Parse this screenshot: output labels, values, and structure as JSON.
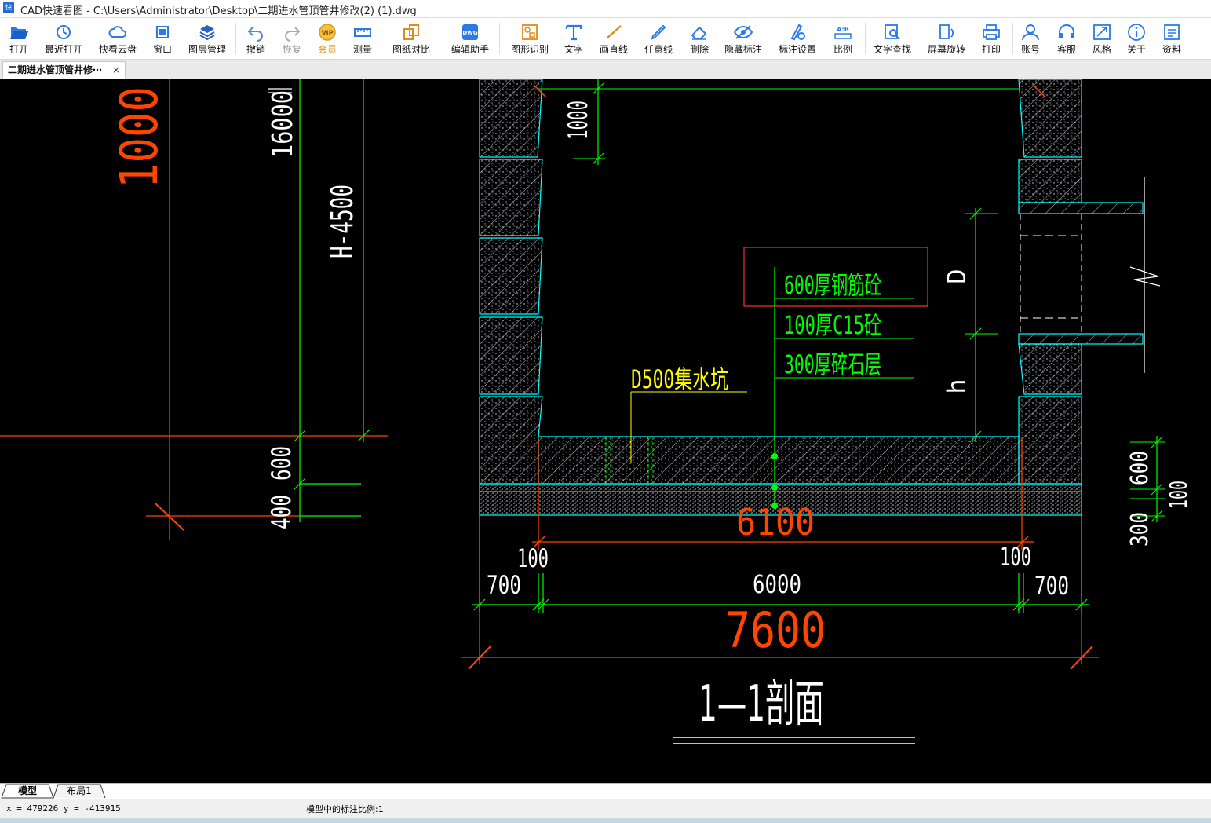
{
  "window": {
    "title": "CAD快速看图 - C:\\Users\\Administrator\\Desktop\\二期进水管顶管井修改(2) (1).dwg",
    "logo_text": "快图"
  },
  "toolbar": {
    "open": "打开",
    "recent": "最近打开",
    "cloud": "快看云盘",
    "window": "窗口",
    "layers": "图层管理",
    "undo": "撤销",
    "redo": "恢复",
    "vip": "会员",
    "measure": "测量",
    "compare": "图纸对比",
    "editor": "编辑助手",
    "shape_recog": "图形识别",
    "text": "文字",
    "line": "画直线",
    "freeline": "任意线",
    "delete": "删除",
    "hide_dim": "隐藏标注",
    "dim_settings": "标注设置",
    "scale": "比例",
    "text_find": "文字查找",
    "rotate": "屏幕旋转",
    "print": "打印",
    "account": "账号",
    "service": "客服",
    "style": "风格",
    "about": "关于",
    "resources": "资料"
  },
  "tab": {
    "label": "二期进水管顶管井修⋯",
    "close": "×"
  },
  "drawing": {
    "left": {
      "dim_1000": "1000",
      "dim_16000": "16000",
      "dim_h4500": "H-4500",
      "dim_600": "600",
      "dim_400": "400"
    },
    "inner_top_dim": "1000",
    "labels": {
      "c30": "600厚钢筋砼",
      "c15": "100厚C15砼",
      "gravel": "300厚碎石层",
      "pit": "D500集水坑",
      "D": "D",
      "h": "h"
    },
    "dims": {
      "inner_6100": "6100",
      "wall_100_l": "100",
      "wall_100_r": "100",
      "d700_l": "700",
      "d6000": "6000",
      "d700_r": "700",
      "d7600": "7600"
    },
    "right_dims": {
      "d600": "600",
      "d300": "300",
      "d100": "100"
    },
    "section_title": "1—1剖面",
    "colors": {
      "cyan": "#00ffff",
      "green": "#00ff00",
      "red": "#ff4500",
      "yellow": "#ffff00",
      "white": "#ffffff",
      "box": "#ff3030"
    }
  },
  "layout_tabs": {
    "model": "模型",
    "layout1": "布局1"
  },
  "status": {
    "coords": "x = 479226  y = -413915",
    "scale": "模型中的标注比例:1"
  }
}
